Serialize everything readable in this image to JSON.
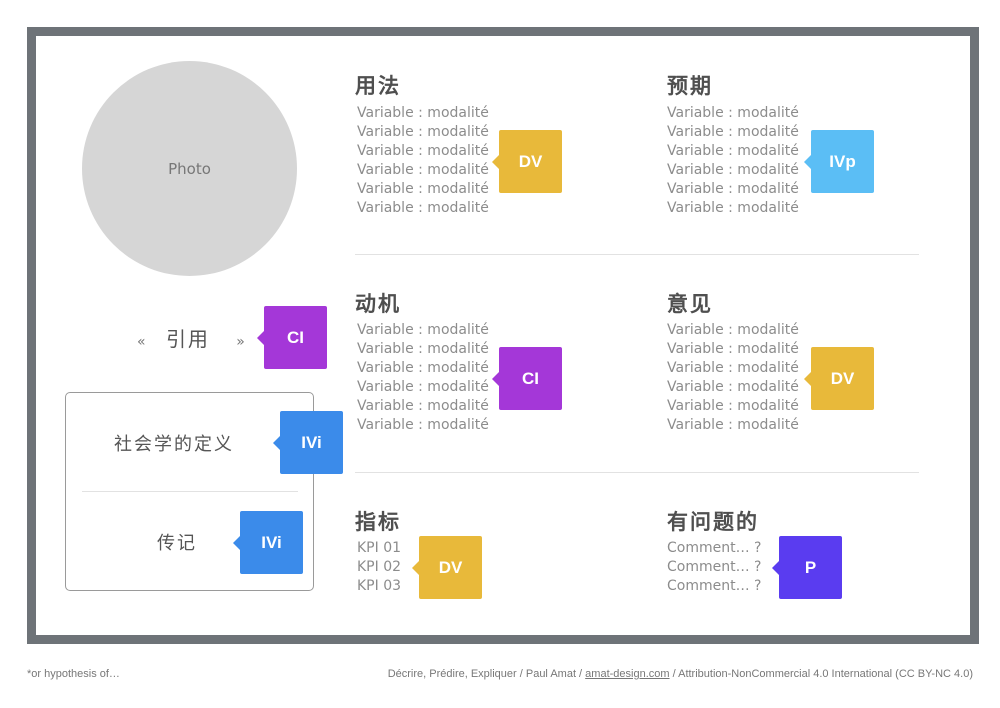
{
  "photo_label": "Photo",
  "quote": {
    "open": "«",
    "text": "引用",
    "close": "»"
  },
  "sections": {
    "usage": {
      "title": "用法",
      "lines": [
        "Variable : modalité",
        "Variable : modalité",
        "Variable : modalité",
        "Variable : modalité",
        "Variable : modalité",
        "Variable : modalité"
      ],
      "tag": "DV"
    },
    "expect": {
      "title": "预期",
      "lines": [
        "Variable : modalité",
        "Variable : modalité",
        "Variable : modalité",
        "Variable : modalité",
        "Variable : modalité",
        "Variable : modalité"
      ],
      "tag": "IVp"
    },
    "motive": {
      "title": "动机",
      "lines": [
        "Variable : modalité",
        "Variable : modalité",
        "Variable : modalité",
        "Variable : modalité",
        "Variable : modalité",
        "Variable : modalité"
      ],
      "tag": "CI"
    },
    "opinion": {
      "title": "意见",
      "lines": [
        "Variable : modalité",
        "Variable : modalité",
        "Variable : modalité",
        "Variable : modalité",
        "Variable : modalité",
        "Variable : modalité"
      ],
      "tag": "DV"
    },
    "indicators": {
      "title": "指标",
      "lines": [
        "KPI 01",
        "KPI 02",
        "KPI 03"
      ],
      "tag": "DV"
    },
    "problems": {
      "title": "有问题的",
      "lines": [
        "Comment… ?",
        "Comment… ?",
        "Comment… ?"
      ],
      "tag": "P"
    }
  },
  "quote_tag": "CI",
  "box": {
    "definition": {
      "label": "社会学的定义",
      "tag": "IVi"
    },
    "biography": {
      "label": "传记",
      "tag": "IVi"
    }
  },
  "colors": {
    "DV": "#e8b93a",
    "IVp": "#5bbef5",
    "CI": "#a437d8",
    "IVi": "#3b8bea",
    "P": "#5a3cf0",
    "frame": "#6e7378"
  },
  "footer": {
    "left": "*or hypothesis of…",
    "right_prefix": "Décrire, Prédire, Expliquer / Paul Amat / ",
    "right_link": "amat-design.com",
    "right_suffix": " / Attribution-NonCommercial 4.0 International (CC BY-NC 4.0)"
  }
}
